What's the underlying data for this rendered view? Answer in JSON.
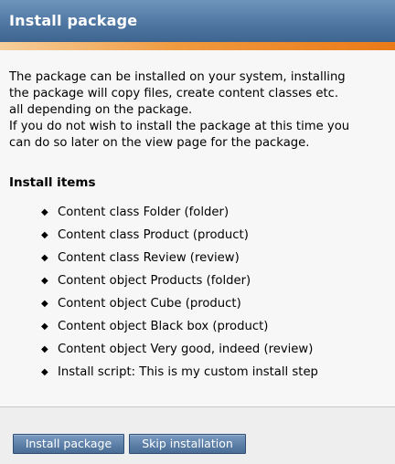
{
  "header": {
    "title": "Install package"
  },
  "description": {
    "lines": [
      "The package can be installed on your system, installing",
      "the package will copy files, create content classes etc.",
      "all depending on the package.",
      "If you do not wish to install the package at this time you",
      "can do so later on the view page for the package."
    ]
  },
  "install_items": {
    "heading": "Install items",
    "bullet_glyph": "◆",
    "items": [
      "Content class Folder (folder)",
      "Content class Product (product)",
      "Content class Review (review)",
      "Content object Products (folder)",
      "Content object Cube (product)",
      "Content object Black box (product)",
      "Content object Very good, indeed (review)",
      "Install script: This is my custom install step"
    ]
  },
  "footer": {
    "install_button_label": "Install package",
    "skip_button_label": "Skip installation"
  },
  "colors": {
    "title_bar": "#4f77a2",
    "accent_strip": "#f09a3f",
    "button": "#5a7da6"
  }
}
